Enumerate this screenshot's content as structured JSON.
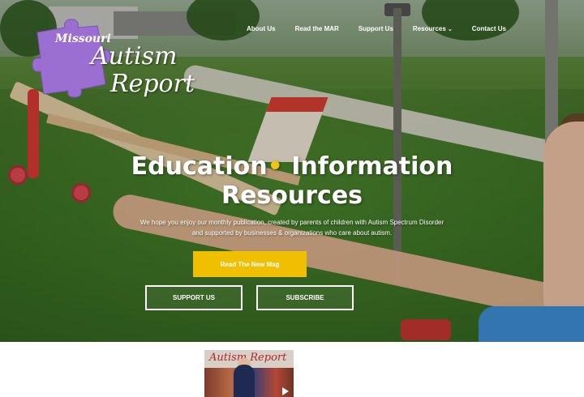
{
  "nav": {
    "items": [
      {
        "label": "About Us"
      },
      {
        "label": "Read the MAR"
      },
      {
        "label": "Support Us"
      },
      {
        "label": "Resources",
        "has_dropdown": true
      },
      {
        "label": "Contact Us"
      }
    ]
  },
  "logo": {
    "line1": "Missouri",
    "line2": "Autism",
    "line3": "Report",
    "icon": "puzzle-piece-icon",
    "color": "#9b6fd1"
  },
  "hero": {
    "headline_part1": "Education",
    "headline_dot": "•",
    "headline_part2": " Information",
    "headline_line2": "Resources",
    "subtext_line1": "We hope you enjoy our monthly publication, created by parents of children with Autism Spectrum Disorder",
    "subtext_line2": "and supported by businesses & organizations who care about autism.",
    "primary_button": "Read The New Mag",
    "primary_color": "#f0c000",
    "secondary_buttons": [
      "SUPPORT US",
      "SUBSCRIBE"
    ]
  },
  "thumbnail": {
    "title": "Autism Report",
    "icon": "play-icon"
  }
}
